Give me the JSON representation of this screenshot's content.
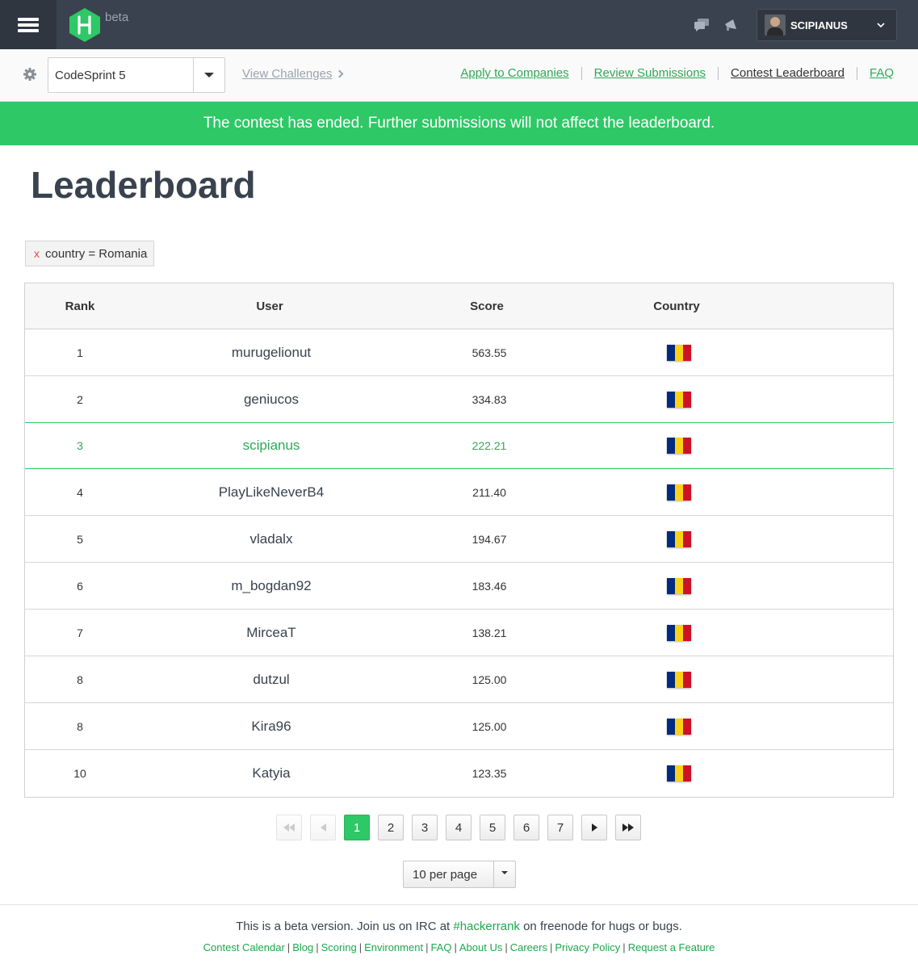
{
  "header": {
    "beta_label": "beta",
    "user_name": "SCIPIANUS"
  },
  "subnav": {
    "contest_value": "CodeSprint 5",
    "view_challenges": "View Challenges",
    "links": [
      "Apply to Companies",
      "Review Submissions",
      "Contest Leaderboard",
      "FAQ"
    ],
    "current_link": "Contest Leaderboard"
  },
  "banner": "The contest has ended. Further submissions will not affect the leaderboard.",
  "page_title": "Leaderboard",
  "filter": {
    "remove_label": "x",
    "text": "country = Romania"
  },
  "table": {
    "columns": [
      "Rank",
      "User",
      "Score",
      "Country"
    ],
    "rows": [
      {
        "rank": "1",
        "user": "murugelionut",
        "score": "563.55",
        "country": "Romania"
      },
      {
        "rank": "2",
        "user": "geniucos",
        "score": "334.83",
        "country": "Romania"
      },
      {
        "rank": "3",
        "user": "scipianus",
        "score": "222.21",
        "country": "Romania",
        "current_user": true
      },
      {
        "rank": "4",
        "user": "PlayLikeNeverB4",
        "score": "211.40",
        "country": "Romania"
      },
      {
        "rank": "5",
        "user": "vladalx",
        "score": "194.67",
        "country": "Romania"
      },
      {
        "rank": "6",
        "user": "m_bogdan92",
        "score": "183.46",
        "country": "Romania"
      },
      {
        "rank": "7",
        "user": "MirceaT",
        "score": "138.21",
        "country": "Romania"
      },
      {
        "rank": "8",
        "user": "dutzul",
        "score": "125.00",
        "country": "Romania"
      },
      {
        "rank": "8",
        "user": "Kira96",
        "score": "125.00",
        "country": "Romania"
      },
      {
        "rank": "10",
        "user": "Katyia",
        "score": "123.35",
        "country": "Romania"
      }
    ]
  },
  "pagination": {
    "pages": [
      "1",
      "2",
      "3",
      "4",
      "5",
      "6",
      "7"
    ],
    "current": "1",
    "per_page": "10 per page"
  },
  "footer": {
    "msg_before": "This is a beta version. Join us on IRC at ",
    "irc_link": "#hackerrank",
    "msg_after": " on freenode for hugs or bugs.",
    "links": [
      "Contest Calendar",
      "Blog",
      "Scoring",
      "Environment",
      "FAQ",
      "About Us",
      "Careers",
      "Privacy Policy",
      "Request a Feature"
    ]
  },
  "colors": {
    "accent_green": "#2ec866",
    "topbar": "#39424e",
    "flag_blue": "#002b7f",
    "flag_yellow": "#fcd116",
    "flag_red": "#ce1126"
  },
  "icons": {
    "menu": "hamburger-icon",
    "logo": "hackerrank-logo",
    "messages": "chat-bubbles-icon",
    "notifications": "megaphone-icon",
    "settings": "gear-icon"
  }
}
